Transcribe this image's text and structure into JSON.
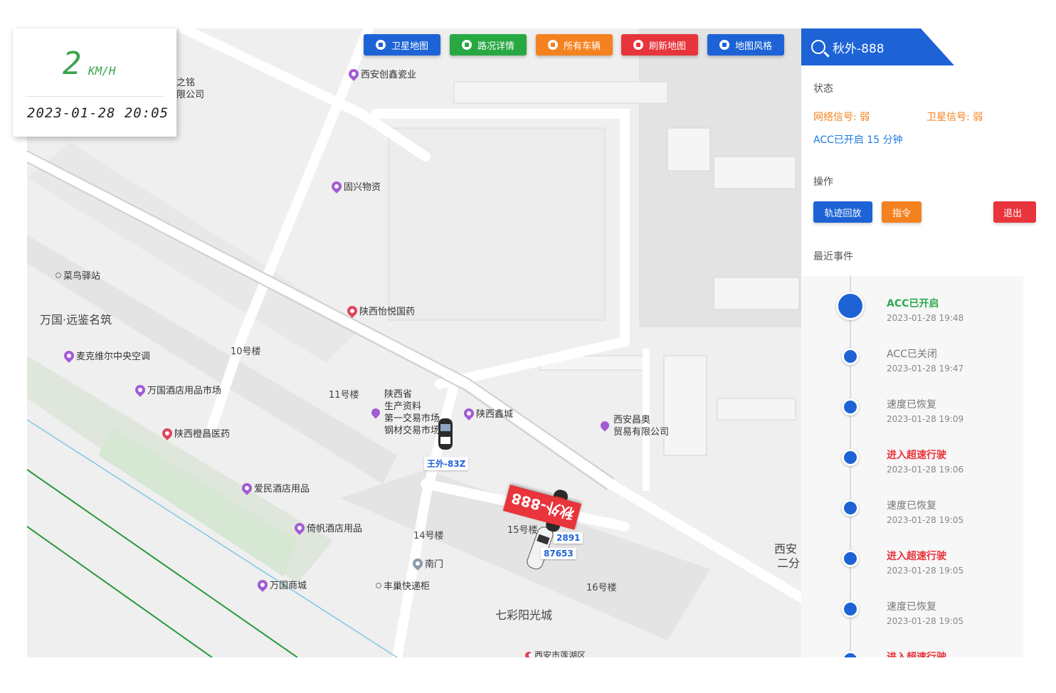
{
  "speed": {
    "value": "2",
    "unit": "KM/H",
    "datetime": "2023-01-28 20:05"
  },
  "toolbar": [
    {
      "label": "卫星地图",
      "color": "blue"
    },
    {
      "label": "路况详情",
      "color": "green"
    },
    {
      "label": "所有车辆",
      "color": "orange"
    },
    {
      "label": "刷新地图",
      "color": "red"
    },
    {
      "label": "地图风格",
      "color": "blue"
    }
  ],
  "search": {
    "query": "秋外-888"
  },
  "panel": {
    "status_title": "状态",
    "network_signal": "网络信号: 弱",
    "satellite_signal": "卫星信号: 弱",
    "acc_status": "ACC已开启 15 分钟",
    "ops_title": "操作",
    "btn_playback": "轨迹回放",
    "btn_command": "指令",
    "btn_logout": "退出",
    "events_title": "最近事件"
  },
  "events": [
    {
      "title": "ACC已开启",
      "time": "2023-01-28 19:48",
      "color": "#2fa84f"
    },
    {
      "title": "ACC已关闭",
      "time": "2023-01-28 19:47",
      "color": "#777777"
    },
    {
      "title": "速度已恢复",
      "time": "2023-01-28 19:09",
      "color": "#777777"
    },
    {
      "title": "进入超速行驶",
      "time": "2023-01-28 19:06",
      "color": "#e8343b"
    },
    {
      "title": "速度已恢复",
      "time": "2023-01-28 19:05",
      "color": "#777777"
    },
    {
      "title": "进入超速行驶",
      "time": "2023-01-28 19:05",
      "color": "#e8343b"
    },
    {
      "title": "速度已恢复",
      "time": "2023-01-28 19:05",
      "color": "#777777"
    },
    {
      "title": "进入超速行驶",
      "time": "",
      "color": "#e8343b"
    }
  ],
  "map": {
    "pois": {
      "xian_chuangxin": "西安创鑫瓷业",
      "guxing": "固兴物资",
      "yiyue": "陕西怡悦国药",
      "cainiao": "菜鸟驿站",
      "maikewei": "麦克维尔中央空调",
      "wanguo_hotel": "万国酒店用品市场",
      "chengchang": "陕西橙昌医药",
      "aimin": "爱民酒店用品",
      "yifan": "倚帆酒店用品",
      "wanguo_mall": "万国商城",
      "xinxincheng": "陕西鑫城",
      "changao_1": "西安昌奥",
      "changao_2": "贸易有限公司",
      "nanmen": "南门",
      "fengchao": "丰巢快递柜",
      "lianhu": "西安市莲湖区",
      "zhiming_1": "之铭",
      "zhiming_2": "限公司"
    },
    "areas": {
      "wanguo_yuanjian": "万国·远鉴名筑",
      "qicai": "七彩阳光城",
      "xian_partial_1": "西安",
      "xian_partial_2": "二分"
    },
    "buildings": {
      "b10": "10号楼",
      "b11": "11号楼",
      "b14": "14号楼",
      "b15": "15号楼",
      "b16": "16号楼"
    },
    "market": [
      "陕西省",
      "生产资料",
      "第一交易市场",
      "钢材交易市场"
    ],
    "vehicles": {
      "v1": "王外-83Z",
      "v2": "2891",
      "v3": "87653",
      "selected": "秋外-888"
    }
  }
}
